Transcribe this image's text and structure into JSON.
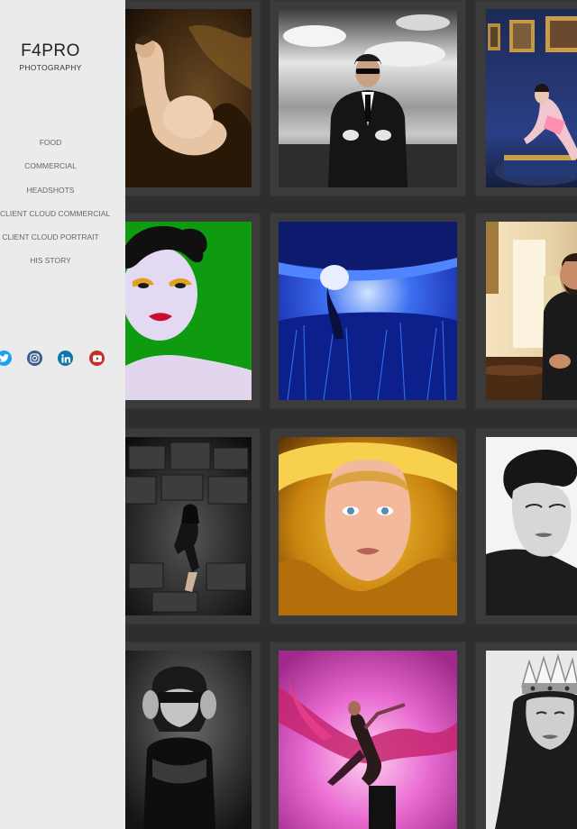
{
  "brand": {
    "title": "F4PRO",
    "subtitle": "PHOTOGRAPHY"
  },
  "nav": {
    "items": [
      {
        "label": "FOOD"
      },
      {
        "label": "COMMERCIAL"
      },
      {
        "label": "HEADSHOTS"
      },
      {
        "label": "CLIENT CLOUD COMMERCIAL"
      },
      {
        "label": "CLIENT CLOUD PORTRAIT"
      },
      {
        "label": "HIS STORY"
      }
    ]
  },
  "social": {
    "icons": [
      "twitter-icon",
      "instagram-icon",
      "linkedin-icon",
      "youtube-icon"
    ],
    "colors": {
      "twitter": "#1da1f2",
      "instagram": "#3a5f8a",
      "linkedin": "#0e76a8",
      "youtube": "#c4302b"
    }
  },
  "colors": {
    "sidebar_bg": "#ebebeb",
    "gallery_bg": "#2e2e2e",
    "tile_bg": "#3b3b3b"
  },
  "gallery": {
    "photos": [
      {
        "name": "photo-pregnant-nude-gold-fabric"
      },
      {
        "name": "photo-man-suit-sunglasses-sky"
      },
      {
        "name": "photo-woman-blue-room-paintings"
      },
      {
        "name": "photo-woman-green-background"
      },
      {
        "name": "photo-blue-wide-angle-reeds"
      },
      {
        "name": "photo-bearded-man-table"
      },
      {
        "name": "photo-woman-sitting-rocks"
      },
      {
        "name": "photo-woman-yellow-scarf"
      },
      {
        "name": "photo-woman-black-white-profile"
      },
      {
        "name": "photo-woman-hands-face-bw"
      },
      {
        "name": "photo-dancer-pink-fabric"
      },
      {
        "name": "photo-woman-crown-bw"
      }
    ]
  }
}
